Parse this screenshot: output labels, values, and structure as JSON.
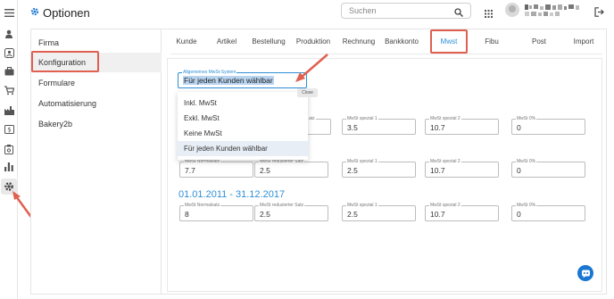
{
  "header": {
    "title": "Optionen",
    "search_placeholder": "Suchen"
  },
  "subnav": {
    "items": [
      {
        "label": "Firma"
      },
      {
        "label": "Konfiguration"
      },
      {
        "label": "Formulare"
      },
      {
        "label": "Automatisierung"
      },
      {
        "label": "Bakery2b"
      }
    ]
  },
  "tabs": [
    {
      "label": "Kunde"
    },
    {
      "label": "Artikel"
    },
    {
      "label": "Bestellung"
    },
    {
      "label": "Produktion"
    },
    {
      "label": "Rechnung"
    },
    {
      "label": "Bankkonto"
    },
    {
      "label": "Mwst"
    },
    {
      "label": "Fibu"
    },
    {
      "label": "Post"
    },
    {
      "label": "Import"
    }
  ],
  "mwst_system": {
    "label": "Allgemeines MwSt-System",
    "value": "Für jeden Kunden wählbar",
    "close_label": "Close",
    "options": [
      {
        "label": "Inkl. MwSt"
      },
      {
        "label": "Exkl. MwSt"
      },
      {
        "label": "Keine MwSt"
      },
      {
        "label": "Für jeden Kunden wählbar"
      }
    ]
  },
  "labels": {
    "normal": "MwSt Normalsatz",
    "reduced": "MwSt reduzierter Satz",
    "special1": "MwSt spezial 1",
    "special2": "MwSt spezial 2",
    "zero": "MwSt 0%",
    "reduced_partial": "atz"
  },
  "row1": {
    "special1": "3.5",
    "special2": "10.7",
    "zero": "0"
  },
  "row2": {
    "normal": "7.7",
    "reduced": "2.5",
    "special1": "2.5",
    "special2": "10.7",
    "zero": "0"
  },
  "section2": {
    "heading": "01.01.2011 - 31.12.2017",
    "normal": "8",
    "reduced": "2.5",
    "special1": "2.5",
    "special2": "10.7",
    "zero": "0"
  },
  "colors": {
    "accent": "#2f8fd6",
    "highlight": "#e06050"
  }
}
